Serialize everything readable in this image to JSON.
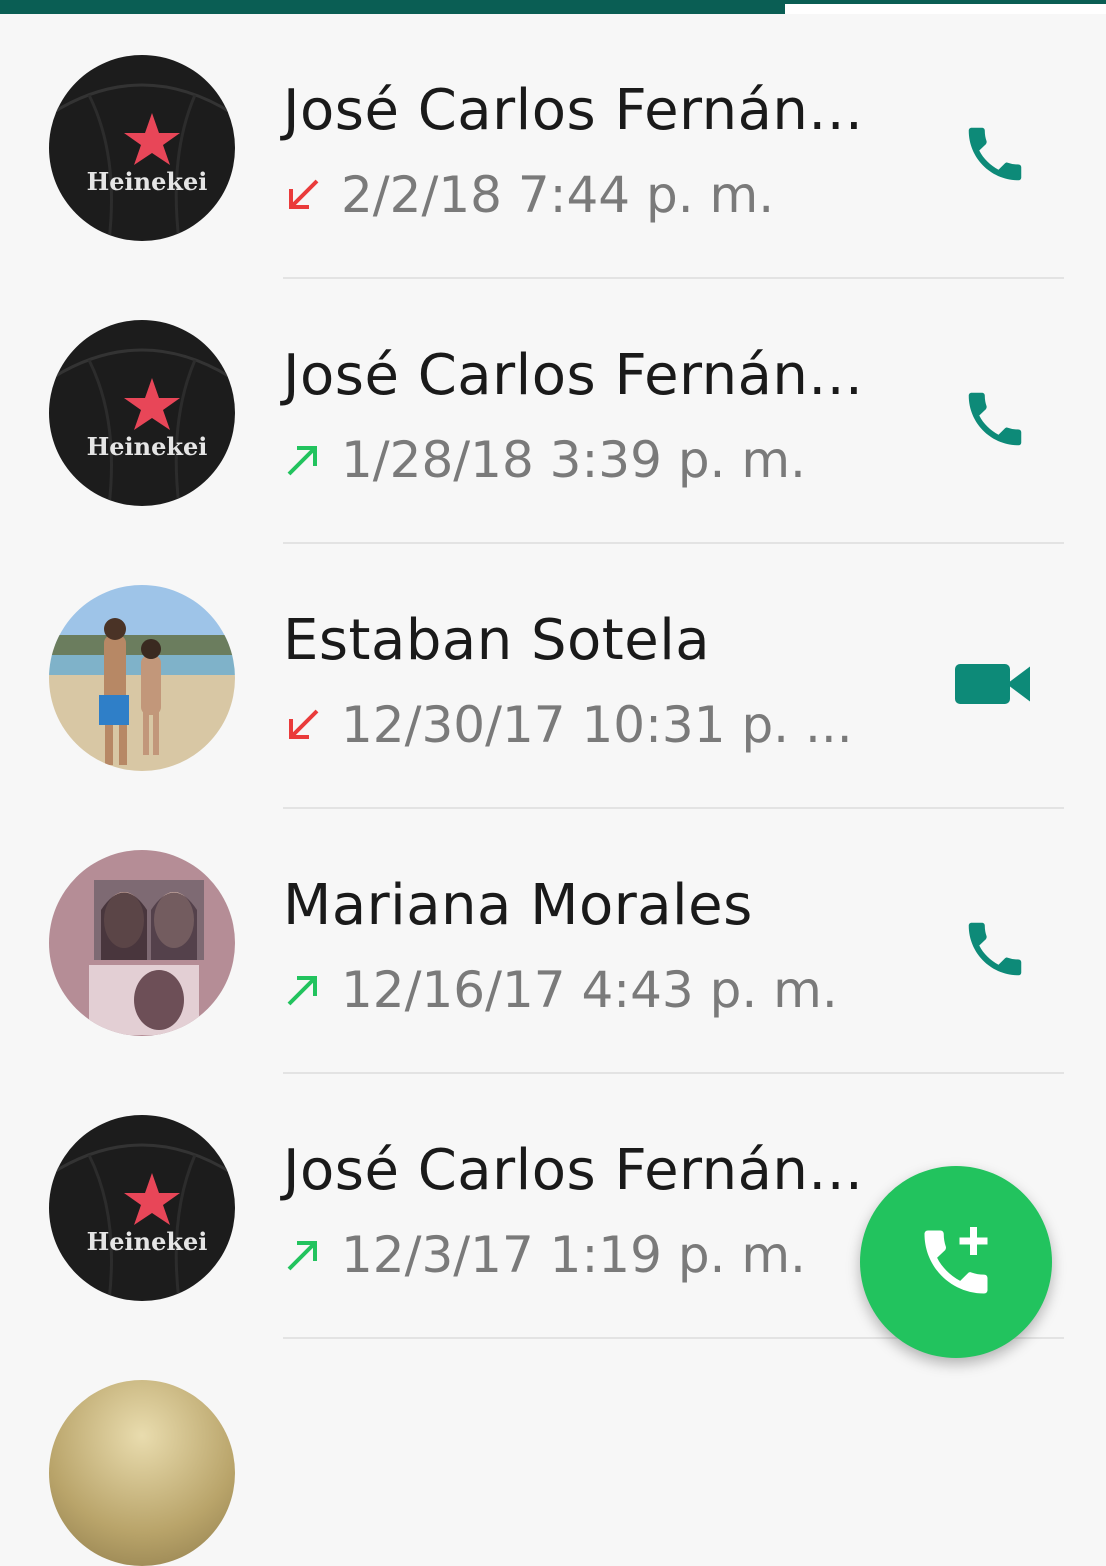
{
  "colors": {
    "header": "#0a5e54",
    "accent_teal": "#0d8a78",
    "missed_red": "#ea3b3b",
    "outgoing_green": "#22c35e",
    "fab_green": "#22c35e"
  },
  "calls": [
    {
      "name": "José Carlos Fernán...",
      "datetime": "2/2/18 7:44 p. m.",
      "direction": "incoming-missed",
      "direction_icon": "arrow-down-left-icon",
      "call_type_icon": "phone-icon",
      "avatar": "heineken-cap"
    },
    {
      "name": "José Carlos Fernán...",
      "datetime": "1/28/18 3:39 p. m.",
      "direction": "outgoing",
      "direction_icon": "arrow-up-right-icon",
      "call_type_icon": "phone-icon",
      "avatar": "heineken-cap"
    },
    {
      "name": "Estaban Sotela",
      "datetime": "12/30/17 10:31 p. ...",
      "direction": "incoming-missed",
      "direction_icon": "arrow-down-left-icon",
      "call_type_icon": "video-icon",
      "avatar": "beach-photo"
    },
    {
      "name": "Mariana Morales",
      "datetime": "12/16/17 4:43 p. m.",
      "direction": "outgoing",
      "direction_icon": "arrow-up-right-icon",
      "call_type_icon": "phone-icon",
      "avatar": "two-people-photo"
    },
    {
      "name": "José Carlos Fernán...",
      "datetime": "12/3/17 1:19 p. m.",
      "direction": "outgoing",
      "direction_icon": "arrow-up-right-icon",
      "call_type_icon": "phone-icon",
      "avatar": "heineken-cap"
    }
  ],
  "fab": {
    "icon": "add-call-icon"
  }
}
